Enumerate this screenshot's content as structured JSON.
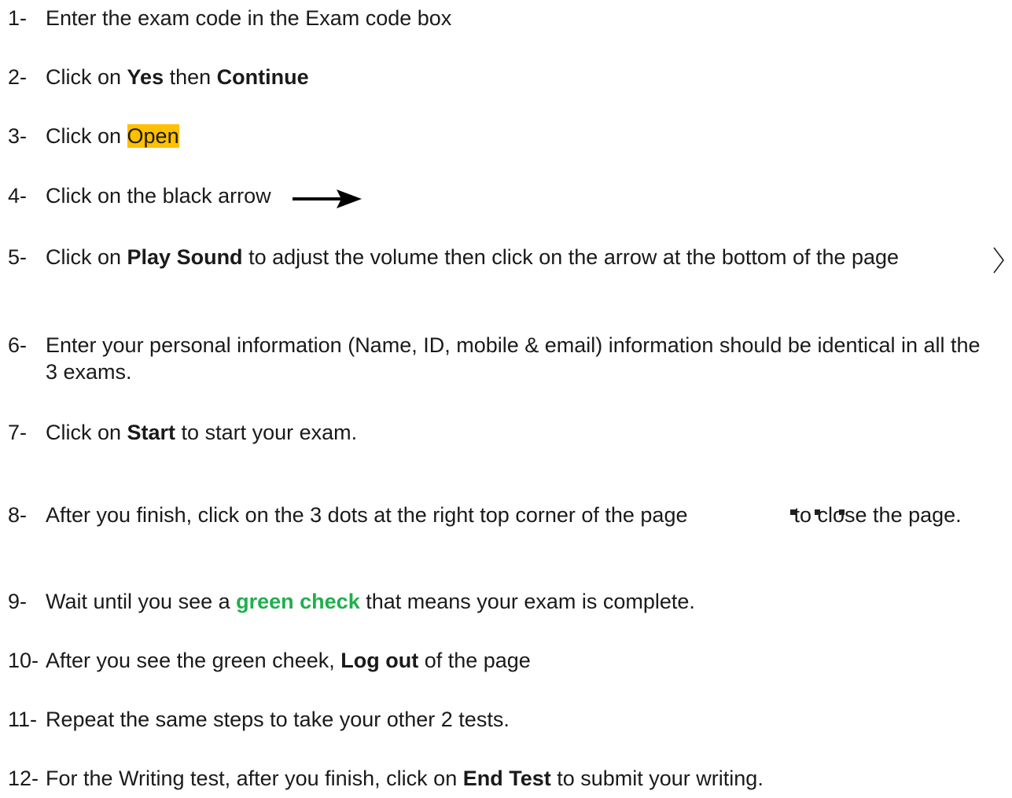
{
  "steps": [
    {
      "num": "1-",
      "parts": [
        {
          "t": "Enter the exam code in the Exam code box"
        }
      ]
    },
    {
      "num": "2-",
      "parts": [
        {
          "t": "Click on "
        },
        {
          "t": "Yes",
          "s": "b"
        },
        {
          "t": " then "
        },
        {
          "t": "Continue",
          "s": "b"
        }
      ]
    },
    {
      "num": "3-",
      "parts": [
        {
          "t": "Click on "
        },
        {
          "t": "Open",
          "s": "hl"
        }
      ]
    },
    {
      "num": "4-",
      "parts": [
        {
          "t": "Click on the black arrow"
        }
      ]
    },
    {
      "num": "5-",
      "parts": [
        {
          "t": "Click on "
        },
        {
          "t": "Play Sound",
          "s": "b"
        },
        {
          "t": " to adjust the volume then click on the arrow at the bottom of the page"
        }
      ]
    },
    {
      "num": "6-",
      "parts": [
        {
          "t": "Enter your personal information (Name, ID, mobile & email) information should be identical in all the 3 exams."
        }
      ]
    },
    {
      "num": "7-",
      "parts": [
        {
          "t": "Click on "
        },
        {
          "t": "Start",
          "s": "b"
        },
        {
          "t": " to start your exam."
        }
      ]
    },
    {
      "num": "8-",
      "parts": [
        {
          "t": "After you finish, click on the 3 dots at the right top corner of the page                  to close the page."
        }
      ]
    },
    {
      "num": "9-",
      "parts": [
        {
          "t": "Wait until you see a "
        },
        {
          "t": "green check",
          "s": "g"
        },
        {
          "t": " that means your exam is complete."
        }
      ]
    },
    {
      "num": "10-",
      "parts": [
        {
          "t": "After you see the green cheek, "
        },
        {
          "t": "Log out",
          "s": "b"
        },
        {
          "t": " of the page"
        }
      ]
    },
    {
      "num": "11-",
      "parts": [
        {
          "t": "Repeat the same steps to take your other 2 tests."
        }
      ]
    },
    {
      "num": "12-",
      "parts": [
        {
          "t": "For the Writing test, after you finish, click on "
        },
        {
          "t": "End Test",
          "s": "b"
        },
        {
          "t": " to submit your writing."
        }
      ]
    }
  ],
  "icons": {
    "arrow": "right-arrow-icon",
    "chevron": "chevron-right-icon",
    "dots": "three-dots-icon"
  },
  "colors": {
    "highlight": "#ffc000",
    "green": "#1fb04c"
  }
}
